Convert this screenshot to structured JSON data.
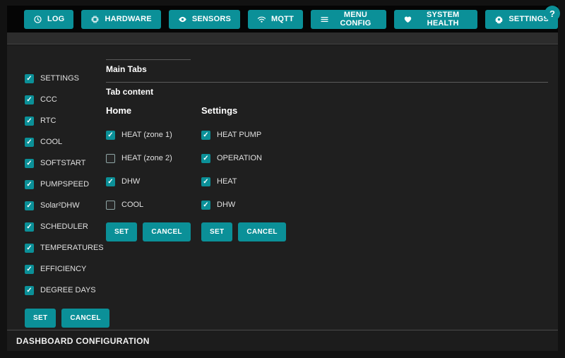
{
  "colors": {
    "accent": "#0b9098"
  },
  "nav": {
    "items": [
      {
        "label": "LOG",
        "icon": "clock-icon"
      },
      {
        "label": "HARDWARE",
        "icon": "chip-icon"
      },
      {
        "label": "SENSORS",
        "icon": "eye-icon"
      },
      {
        "label": "MQTT",
        "icon": "wifi-icon"
      },
      {
        "label": "MENU CONFIG",
        "icon": "menu-icon"
      },
      {
        "label": "SYSTEM HEALTH",
        "icon": "heart-icon"
      },
      {
        "label": "SETTINGS",
        "icon": "gear-icon"
      }
    ],
    "help_label": "?"
  },
  "sidebar": {
    "items": [
      {
        "label": "SETTINGS",
        "checked": true
      },
      {
        "label": "CCC",
        "checked": true
      },
      {
        "label": "RTC",
        "checked": true
      },
      {
        "label": "COOL",
        "checked": true
      },
      {
        "label": "SOFTSTART",
        "checked": true
      },
      {
        "label": "PUMPSPEED",
        "checked": true
      },
      {
        "label": "Solar²DHW",
        "checked": true
      },
      {
        "label": "SCHEDULER",
        "checked": true
      },
      {
        "label": "TEMPERATURES",
        "checked": true
      },
      {
        "label": "EFFICIENCY",
        "checked": true
      },
      {
        "label": "DEGREE DAYS",
        "checked": true
      }
    ],
    "set_label": "SET",
    "cancel_label": "CANCEL"
  },
  "main": {
    "main_tabs_title": "Main Tabs",
    "tab_content_title": "Tab content",
    "columns": [
      {
        "title": "Home",
        "items": [
          {
            "label": "HEAT (zone 1)",
            "checked": true
          },
          {
            "label": "HEAT (zone 2)",
            "checked": false
          },
          {
            "label": "DHW",
            "checked": true
          },
          {
            "label": "COOL",
            "checked": false
          }
        ],
        "set_label": "SET",
        "cancel_label": "CANCEL"
      },
      {
        "title": "Settings",
        "items": [
          {
            "label": "HEAT PUMP",
            "checked": true
          },
          {
            "label": "OPERATION",
            "checked": true
          },
          {
            "label": "HEAT",
            "checked": true
          },
          {
            "label": "DHW",
            "checked": true
          }
        ],
        "set_label": "SET",
        "cancel_label": "CANCEL"
      }
    ]
  },
  "footer": {
    "title": "DASHBOARD CONFIGURATION"
  }
}
